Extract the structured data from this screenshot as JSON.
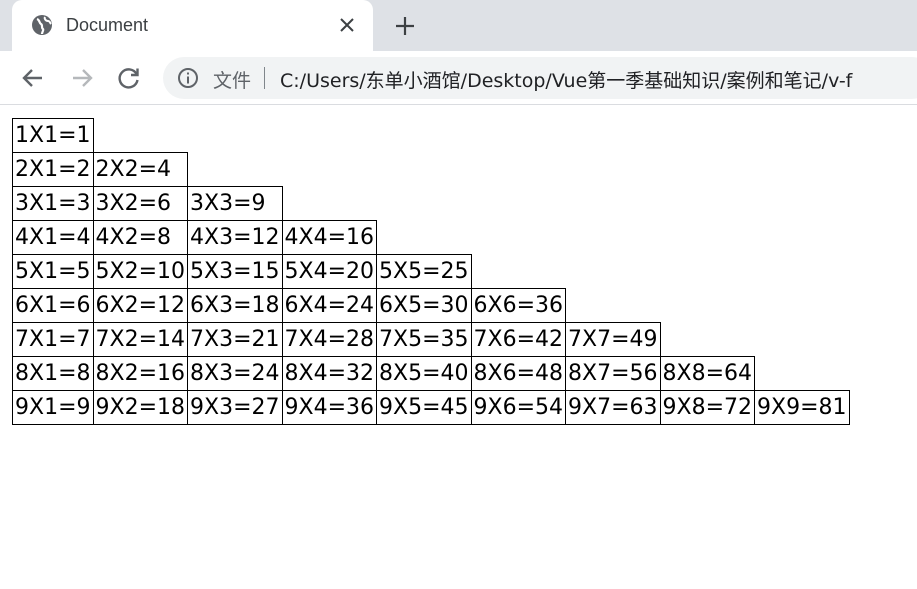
{
  "browser": {
    "tab": {
      "title": "Document",
      "favicon_icon": "globe-icon",
      "close_icon": "close-icon"
    },
    "new_tab_icon": "plus-icon",
    "toolbar": {
      "back_icon": "back-arrow-icon",
      "forward_icon": "forward-arrow-icon",
      "reload_icon": "reload-icon",
      "info_icon": "info-icon",
      "scheme_label": "文件",
      "url": "C:/Users/东单小酒馆/Desktop/Vue第一季基础知识/案例和笔记/v-f"
    }
  },
  "multiplication_table": {
    "rows": [
      [
        "1X1=1"
      ],
      [
        "2X1=2",
        "2X2=4"
      ],
      [
        "3X1=3",
        "3X2=6",
        "3X3=9"
      ],
      [
        "4X1=4",
        "4X2=8",
        "4X3=12",
        "4X4=16"
      ],
      [
        "5X1=5",
        "5X2=10",
        "5X3=15",
        "5X4=20",
        "5X5=25"
      ],
      [
        "6X1=6",
        "6X2=12",
        "6X3=18",
        "6X4=24",
        "6X5=30",
        "6X6=36"
      ],
      [
        "7X1=7",
        "7X2=14",
        "7X3=21",
        "7X4=28",
        "7X5=35",
        "7X6=42",
        "7X7=49"
      ],
      [
        "8X1=8",
        "8X2=16",
        "8X3=24",
        "8X4=32",
        "8X5=40",
        "8X6=48",
        "8X7=56",
        "8X8=64"
      ],
      [
        "9X1=9",
        "9X2=18",
        "9X3=27",
        "9X4=36",
        "9X5=45",
        "9X6=54",
        "9X7=63",
        "9X8=72",
        "9X9=81"
      ]
    ]
  }
}
